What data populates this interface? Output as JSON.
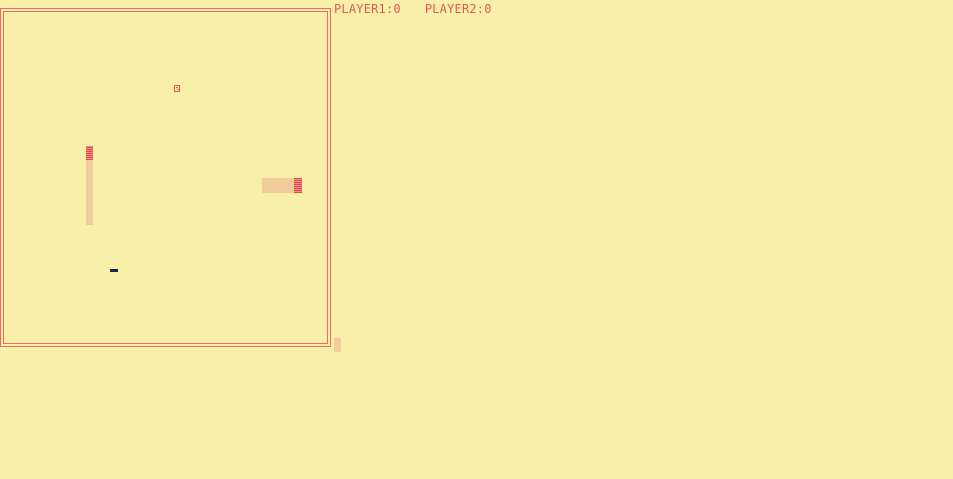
{
  "scoreboard": {
    "player1": "PLAYER1:0",
    "player2": "PLAYER2:0"
  },
  "colors": {
    "background": "#f8f0a8",
    "border": "#ee6b6b",
    "snake": "#e24c4c",
    "text": "#e05a5a",
    "token": "#1a2355"
  },
  "entities": {
    "food": "food-icon",
    "snake1": "snake-vertical",
    "snake2": "snake-horizontal",
    "player_marker": "player-token"
  }
}
